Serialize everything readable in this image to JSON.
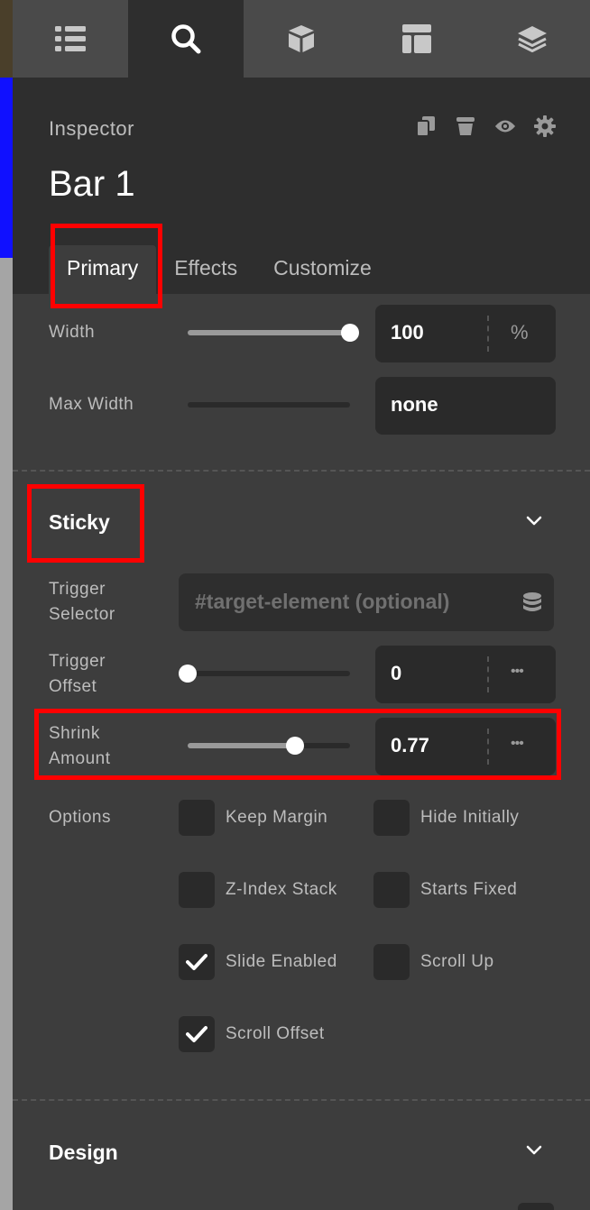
{
  "toolbar": {
    "items": [
      {
        "icon": "list-icon"
      },
      {
        "icon": "search-icon",
        "active": true
      },
      {
        "icon": "cube-icon"
      },
      {
        "icon": "layout-icon"
      },
      {
        "icon": "layers-icon"
      }
    ]
  },
  "inspector": {
    "label": "Inspector",
    "element_title": "Bar 1",
    "actions": [
      "duplicate-icon",
      "delete-icon",
      "visibility-icon",
      "settings-icon"
    ],
    "tabs": [
      {
        "label": "Primary",
        "active": true
      },
      {
        "label": "Effects"
      },
      {
        "label": "Customize"
      }
    ]
  },
  "size": {
    "width": {
      "label": "Width",
      "value": "100",
      "unit": "%",
      "level": 1.0
    },
    "max_width": {
      "label": "Max Width",
      "value": "none"
    }
  },
  "sticky": {
    "title": "Sticky",
    "trigger_selector": {
      "label_1": "Trigger",
      "label_2": "Selector",
      "placeholder": "#target-element (optional)"
    },
    "trigger_offset": {
      "label_1": "Trigger",
      "label_2": "Offset",
      "value": "0",
      "more": "•••",
      "level": 0.0
    },
    "shrink_amount": {
      "label_1": "Shrink",
      "label_2": "Amount",
      "value": "0.77",
      "more": "•••",
      "level": 0.66
    },
    "options_label": "Options",
    "options": [
      {
        "label": "Keep Margin",
        "checked": false
      },
      {
        "label": "Hide Initially",
        "checked": false
      },
      {
        "label": "Z-Index Stack",
        "checked": false
      },
      {
        "label": "Starts Fixed",
        "checked": false
      },
      {
        "label": "Slide Enabled",
        "checked": true
      },
      {
        "label": "Scroll Up",
        "checked": false
      },
      {
        "label": "Scroll Offset",
        "checked": true
      }
    ]
  },
  "design": {
    "title": "Design"
  },
  "colors": {
    "highlight": "#ff0000",
    "panel": "#3d3d3d",
    "header": "#2e2e2e"
  }
}
